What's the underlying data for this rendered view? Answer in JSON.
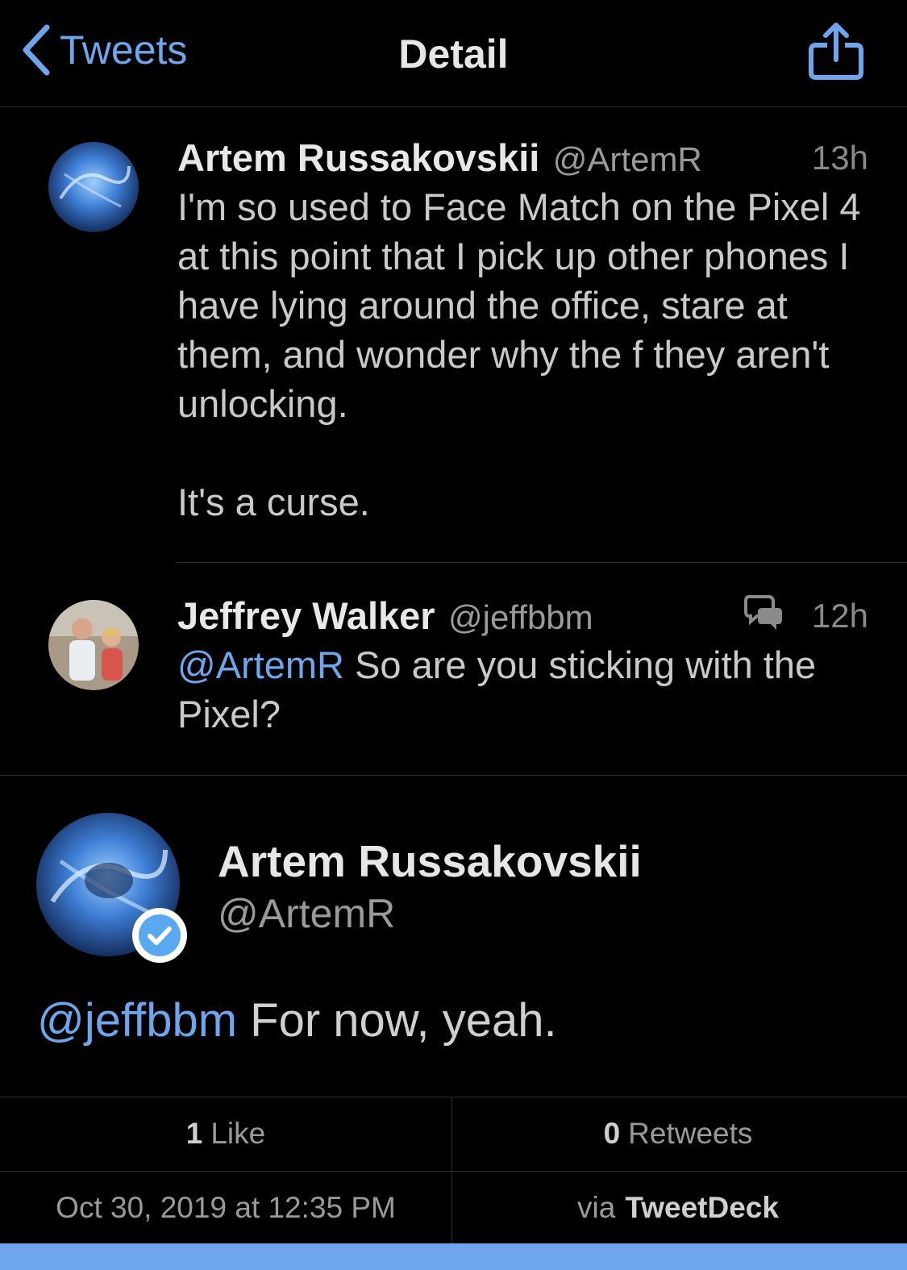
{
  "nav": {
    "back_label": "Tweets",
    "title": "Detail"
  },
  "thread": [
    {
      "name": "Artem Russakovskii",
      "handle": "@ArtemR",
      "time": "13h",
      "text": "I'm so used to Face Match on the Pixel 4 at this point that I pick up other phones I have lying around the office, stare at them, and wonder why the f they aren't unlocking.\n\nIt's a curse."
    },
    {
      "name": "Jeffrey Walker",
      "handle": "@jeffbbm",
      "time": "12h",
      "mention": "@ArtemR",
      "text": " So are you sticking with the Pixel?"
    }
  ],
  "main_tweet": {
    "name": "Artem Russakovskii",
    "handle": "@ArtemR",
    "mention": "@jeffbbm",
    "text": " For now, yeah."
  },
  "stats": {
    "likes_count": "1",
    "likes_label": "Like",
    "retweets_count": "0",
    "retweets_label": "Retweets",
    "date": "Oct 30, 2019 at 12:35 PM",
    "via_prefix": "via",
    "via_client": "TweetDeck"
  },
  "colors": {
    "accent": "#6ea6ee",
    "background": "#000000"
  }
}
